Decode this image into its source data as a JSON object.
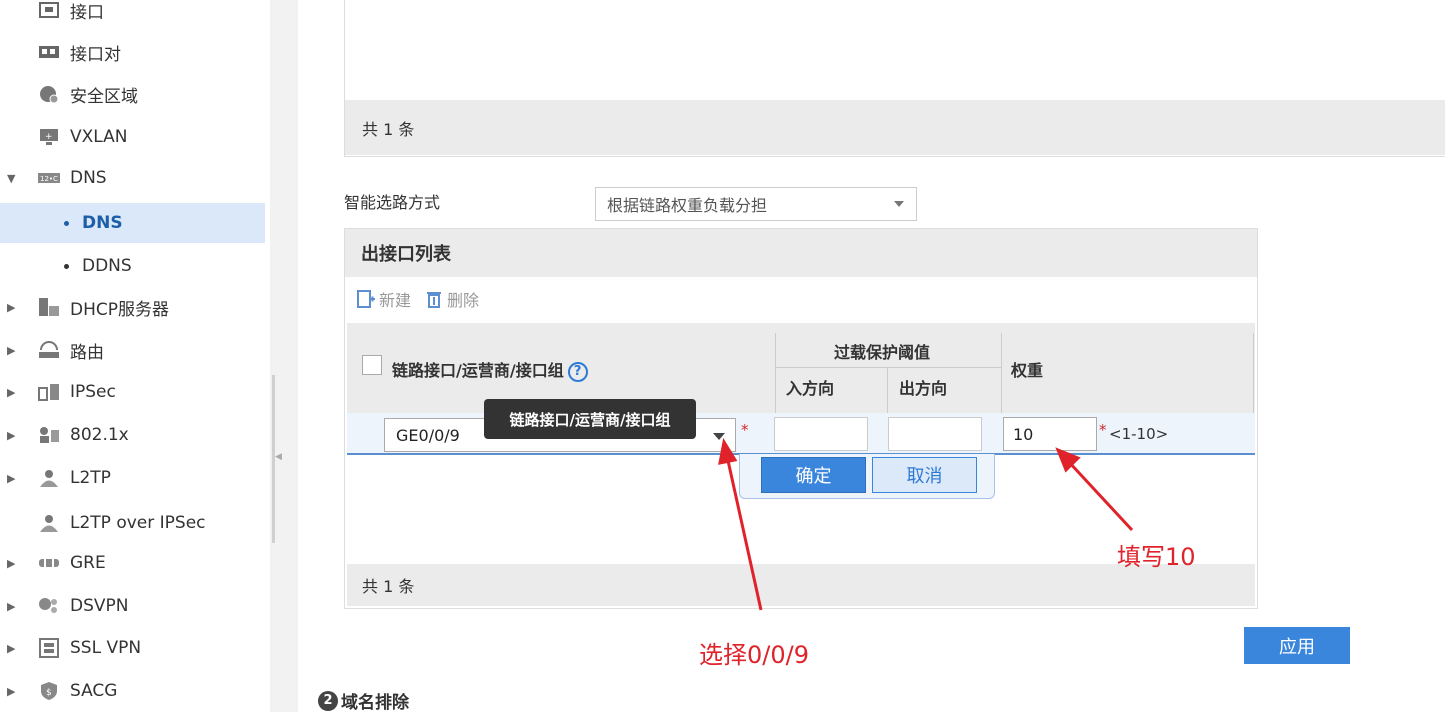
{
  "sidebar": {
    "items": [
      {
        "label": "接口",
        "icon": "interface-icon",
        "expandable": false
      },
      {
        "label": "接口对",
        "icon": "interface-pair-icon",
        "expandable": false
      },
      {
        "label": "安全区域",
        "icon": "security-zone-icon",
        "expandable": false
      },
      {
        "label": "VXLAN",
        "icon": "vxlan-icon",
        "expandable": false
      },
      {
        "label": "DNS",
        "icon": "dns-icon",
        "expandable": true,
        "expanded": true
      },
      {
        "label": "DNS",
        "sub": true,
        "active": true
      },
      {
        "label": "DDNS",
        "sub": true
      },
      {
        "label": "DHCP服务器",
        "icon": "dhcp-server-icon",
        "expandable": true
      },
      {
        "label": "路由",
        "icon": "router-icon",
        "expandable": true
      },
      {
        "label": "IPSec",
        "icon": "ipsec-icon",
        "expandable": true
      },
      {
        "label": "802.1x",
        "icon": "8021x-icon",
        "expandable": true
      },
      {
        "label": "L2TP",
        "icon": "l2tp-icon",
        "expandable": true
      },
      {
        "label": "L2TP over IPSec",
        "icon": "l2tp-ipsec-icon",
        "expandable": false
      },
      {
        "label": "GRE",
        "icon": "gre-icon",
        "expandable": true
      },
      {
        "label": "DSVPN",
        "icon": "dsvpn-icon",
        "expandable": true
      },
      {
        "label": "SSL VPN",
        "icon": "ssl-vpn-icon",
        "expandable": true
      },
      {
        "label": "SACG",
        "icon": "sacg-icon",
        "expandable": true
      }
    ]
  },
  "top_table": {
    "footer": "共 1 条"
  },
  "route_mode": {
    "label": "智能选路方式",
    "value": "根据链路权重负载分担"
  },
  "out_interface": {
    "title": "出接口列表",
    "toolbar": {
      "new": "新建",
      "delete": "删除"
    },
    "columns": {
      "link": "链路接口/运营商/接口组",
      "help": "?",
      "overload": "过载保护阈值",
      "inbound": "入方向",
      "outbound": "出方向",
      "weight": "权重"
    },
    "edit_row": {
      "interface": "GE0/0/9",
      "required": "*",
      "weight": "10",
      "range": "<1-10>"
    },
    "ok": "确定",
    "cancel": "取消",
    "footer": "共 1 条",
    "tooltip": "链路接口/运营商/接口组"
  },
  "apply": "应用",
  "section2": {
    "num": "2",
    "title": "域名排除"
  },
  "annotations": {
    "weight_note": "填写10",
    "select_note": "选择0/0/9",
    "color": "#e0232b"
  }
}
